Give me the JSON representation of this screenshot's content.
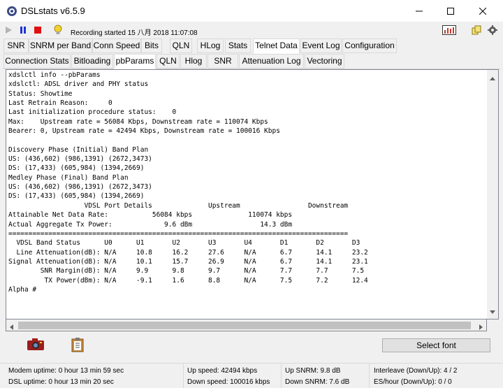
{
  "window": {
    "title": "DSLstats v6.5.9",
    "app_icon": "dslstats-app-icon"
  },
  "toolbar": {
    "play_icon": "play-icon",
    "pause_icon": "pause-icon",
    "stop_icon": "stop-icon",
    "hint_icon": "lightbulb-icon",
    "status_message": "Recording started 15 八月 2018 11:07:08",
    "graph_icon": "graph-icon",
    "copy_icon": "copy-icon",
    "settings_icon": "settings-icon"
  },
  "main_tabs": [
    {
      "label": "SNR"
    },
    {
      "label": "SNRM per Band"
    },
    {
      "label": "Conn Speed"
    },
    {
      "label": "Bits"
    },
    {
      "label": "QLN"
    },
    {
      "label": "HLog"
    },
    {
      "label": "Stats"
    },
    {
      "label": "Telnet Data"
    },
    {
      "label": "Event Log"
    },
    {
      "label": "Configuration"
    }
  ],
  "sub_tabs": [
    {
      "label": "Connection Stats"
    },
    {
      "label": "Bitloading"
    },
    {
      "label": "pbParams"
    },
    {
      "label": "QLN"
    },
    {
      "label": "Hlog"
    },
    {
      "label": "SNR"
    },
    {
      "label": "Attenuation Log"
    },
    {
      "label": "Vectoring"
    }
  ],
  "console_lines": [
    "xdslctl info --pbParams",
    "xdslctl: ADSL driver and PHY status",
    "Status: Showtime",
    "Last Retrain Reason:     0",
    "Last initialization procedure status:    0",
    "Max:    Upstream rate = 56084 Kbps, Downstream rate = 110074 Kbps",
    "Bearer: 0, Upstream rate = 42494 Kbps, Downstream rate = 100016 Kbps",
    "",
    "Discovery Phase (Initial) Band Plan",
    "US: (436,602) (986,1391) (2672,3473)",
    "DS: (17,433) (605,984) (1394,2669)",
    "Medley Phase (Final) Band Plan",
    "US: (436,602) (986,1391) (2672,3473)",
    "DS: (17,433) (605,984) (1394,2669)",
    "                   VDSL Port Details              Upstream                 Downstream",
    "Attainable Net Data Rate:           56084 kbps              110074 kbps",
    "Actual Aggregate Tx Power:             9.6 dBm                 14.3 dBm",
    "=====================================================================================",
    "  VDSL Band Status      U0      U1       U2       U3       U4       D1       D2       D3",
    "  Line Attenuation(dB): N/A     10.8     16.2     27.6     N/A      6.7      14.1     23.2",
    "Signal Attenuation(dB): N/A     10.1     15.7     26.9     N/A      6.7      14.1     23.1",
    "        SNR Margin(dB): N/A     9.9      9.8      9.7      N/A      7.7      7.7      7.5",
    "         TX Power(dBm): N/A     -9.1     1.6      8.8      N/A      7.5      7.2      12.4",
    "Alpha #"
  ],
  "buttons": {
    "select_font": "Select font"
  },
  "status": {
    "modem_uptime": "Modem uptime:  0 hour 13 min 59 sec",
    "dsl_uptime": "DSL uptime:  0 hour 13 min 20 sec",
    "up_speed": "Up speed: 42494 kbps",
    "down_speed": "Down speed: 100016 kbps",
    "up_snrm": "Up SNRM: 9.8 dB",
    "down_snrm": "Down SNRM: 7.6 dB",
    "interleave": "Interleave (Down/Up): 4 / 2",
    "es_hour": "ES/hour (Down/Up): 0 / 0"
  }
}
